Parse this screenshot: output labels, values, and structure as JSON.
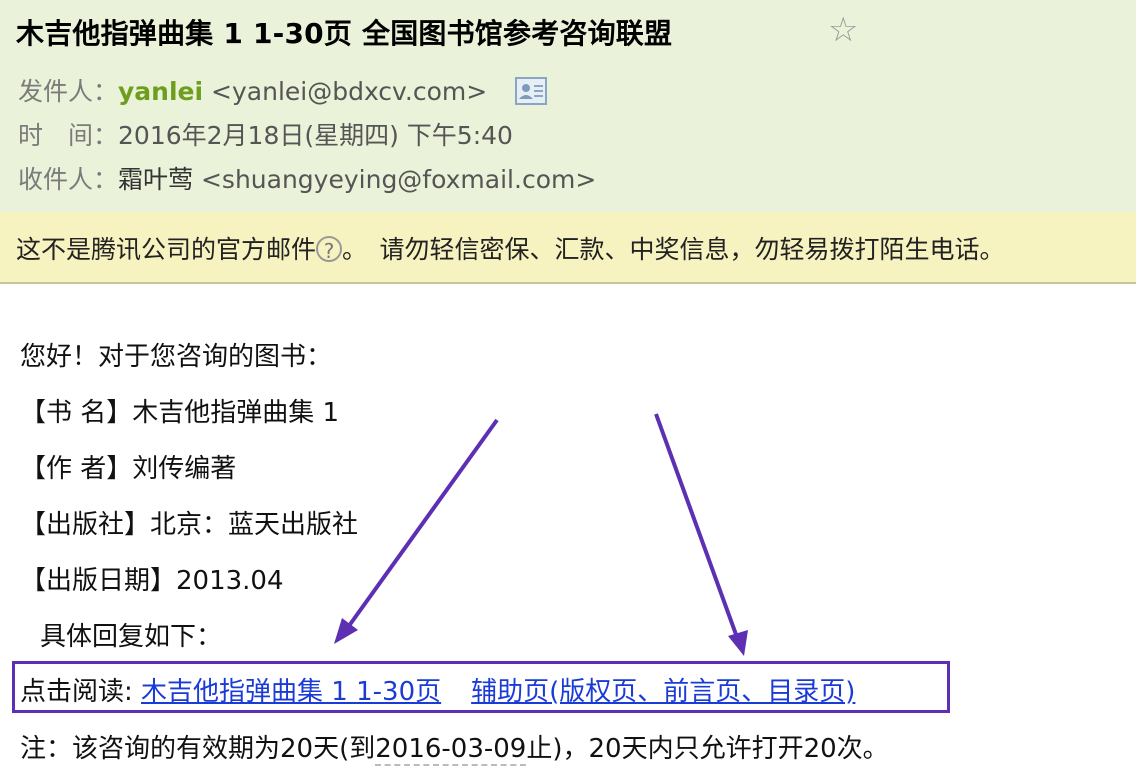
{
  "email": {
    "subject": "木吉他指弹曲集 1 1-30页 全国图书馆参考咨询联盟",
    "star_icon": "star-outline-icon",
    "sender_label": "发件人：",
    "sender_name": "yanlei",
    "sender_address": "<yanlei@bdxcv.com>",
    "contact_card_icon": "contact-card-icon",
    "time_label": "时　间：",
    "time_value": "2016年2月18日(星期四) 下午5:40",
    "recipient_label": "收件人：",
    "recipient_name": "霜叶莺",
    "recipient_address": "<shuangyeying@foxmail.com>"
  },
  "warning": {
    "text_before": "这不是腾讯公司的官方邮件",
    "help_symbol": "?",
    "text_after": "。　请勿轻信密保、汇款、中奖信息，勿轻易拨打陌生电话。"
  },
  "content": {
    "greeting": "您好！对于您咨询的图书：",
    "book_title_line": "【书 名】木吉他指弹曲集 1",
    "author_line": "【作 者】刘传编著",
    "publisher_line": "【出版社】北京：蓝天出版社",
    "pub_date_line": "【出版日期】2013.04",
    "reply_intro": "具体回复如下：",
    "read_label": "点击阅读: ",
    "link_main": "木吉他指弹曲集 1  1-30页",
    "link_aux": "辅助页(版权页、前言页、目录页)",
    "note_prefix": "注：该咨询的有效期为20天(到",
    "note_date": "2016-03-09",
    "note_suffix": "止)，20天内只允许打开20次。"
  },
  "colors": {
    "header_bg": "#eaf3d9",
    "warning_bg": "#f7f3c1",
    "sender_name": "#6f9e1f",
    "link": "#1a3bd6",
    "annotation": "#5c2fb3"
  }
}
